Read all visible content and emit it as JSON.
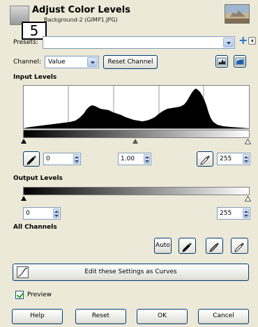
{
  "header": {
    "title": "Adjust Color Levels",
    "subtitle": "Background-2 (GIMP1.JPG)",
    "step_badge": "5"
  },
  "presets": {
    "label": "Presets:",
    "value": ""
  },
  "channel": {
    "label": "Channel:",
    "value": "Value",
    "reset_label": "Reset Channel"
  },
  "input_levels": {
    "title": "Input Levels",
    "black_value": "0",
    "gamma_value": "1.00",
    "white_value": "255"
  },
  "output_levels": {
    "title": "Output Levels",
    "low_value": "0",
    "high_value": "255"
  },
  "all_channels": {
    "title": "All Channels",
    "auto_label": "Auto"
  },
  "curves_button": {
    "label": "Edit these Settings as Curves"
  },
  "preview": {
    "label": "Preview",
    "checked": true
  },
  "footer": {
    "help": "Help",
    "reset": "Reset",
    "ok": "OK",
    "cancel": "Cancel"
  },
  "icons": {
    "header": "levels-icon",
    "add_preset": "plus-icon",
    "preset_menu": "menu-arrow-icon",
    "linear_histogram": "linear-histogram-icon",
    "log_histogram": "log-histogram-icon",
    "pick_black": "eyedropper-black-icon",
    "pick_gray": "eyedropper-gray-icon",
    "pick_white": "eyedropper-white-icon",
    "curves": "curves-icon"
  }
}
